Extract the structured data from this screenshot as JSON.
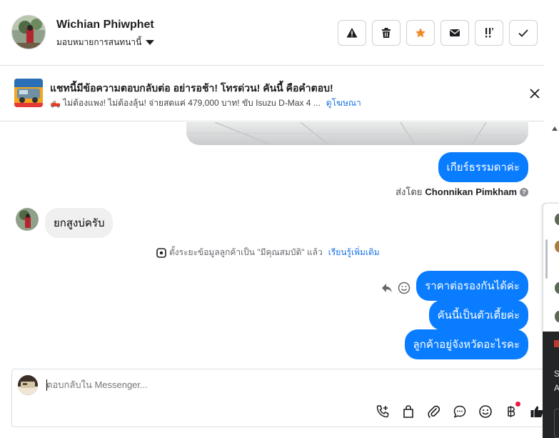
{
  "header": {
    "contact_name": "Wichian Phiwphet",
    "assign_label": "มอบหมายการสนทนานี้",
    "actions": [
      {
        "name": "report-spam-button",
        "icon": "warning-icon"
      },
      {
        "name": "delete-button",
        "icon": "trash-icon"
      },
      {
        "name": "star-button",
        "icon": "star-icon"
      },
      {
        "name": "mark-unread-button",
        "icon": "envelope-icon"
      },
      {
        "name": "follow-up-button",
        "icon": "exclamation-icon"
      },
      {
        "name": "mark-done-button",
        "icon": "check-icon"
      }
    ]
  },
  "banner": {
    "title": "แชทนี้มีข้อความตอบกลับต่อ อย่ารอช้า! โทรด่วน! คันนี้ คือคำตอบ!",
    "subtitle": "🛻 ไม่ต้องแพง! ไม่ต้องลุ้น! จ่ายสดแค่ 479,000 บาท! ขับ Isuzu D-Max 4 ...",
    "link": "ดูโฆษณา"
  },
  "messages": {
    "out_1": "เกียร์ธรรมดาค่ะ",
    "sent_by_prefix": "ส่งโดย",
    "sent_by_name": "Chonnikan Pimkham",
    "in_1": "ยกสูงบ่ครับ",
    "notice_text": "ตั้งระยะข้อมูลลูกค้าเป็น \"มีคุณสมบัติ\" แล้ว",
    "notice_link": "เรียนรู้เพิ่มเติม",
    "out_2": "ราคาต่อรองกันได้ค่ะ",
    "out_3": "คันนี้เป็นตัวเตี้ยค่ะ",
    "out_4": "ลูกค้าอยู่จังหวัดอะไรคะ"
  },
  "composer": {
    "placeholder": "ตอบกลับใน Messenger..."
  },
  "side_panel": {
    "dark_line_1": "S",
    "dark_line_2": "A"
  },
  "colors": {
    "outgoing_bubble": "#0a7cff",
    "incoming_bubble": "#f0f0f0",
    "star": "#f08a24",
    "link": "#1b74e4"
  }
}
